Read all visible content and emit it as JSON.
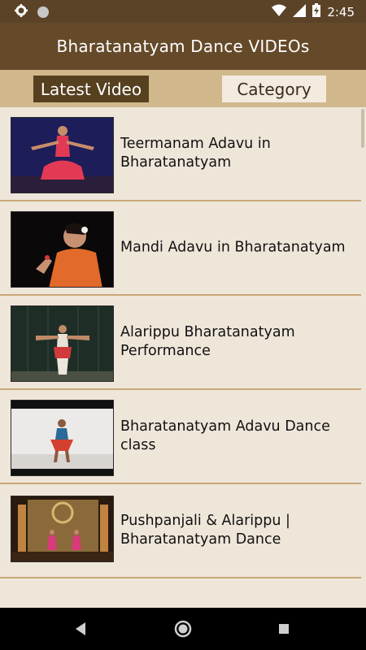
{
  "status_bar": {
    "time": "2:45",
    "icons": [
      "settings-icon",
      "circle-icon",
      "wifi-icon",
      "signal-icon",
      "battery-icon"
    ]
  },
  "app_bar": {
    "title": "Bharatanatyam Dance VIDEOs"
  },
  "tabs": {
    "latest": "Latest Video",
    "category": "Category"
  },
  "videos": [
    {
      "title": "Teermanam Adavu in Bharatanatyam"
    },
    {
      "title": "Mandi Adavu in Bharatanatyam"
    },
    {
      "title": "Alarippu Bharatanatyam Performance"
    },
    {
      "title": "Bharatanatyam Adavu Dance class"
    },
    {
      "title": "Pushpanjali & Alarippu | Bharatanatyam Dance"
    }
  ],
  "nav": {
    "icons": [
      "back-icon",
      "home-icon",
      "recents-icon"
    ]
  },
  "colors": {
    "status_bar": "#5b4327",
    "app_bar": "#654a2a",
    "tab_bar": "#d1b88c",
    "list_bg": "#efe6da",
    "divider": "#c7a878"
  }
}
